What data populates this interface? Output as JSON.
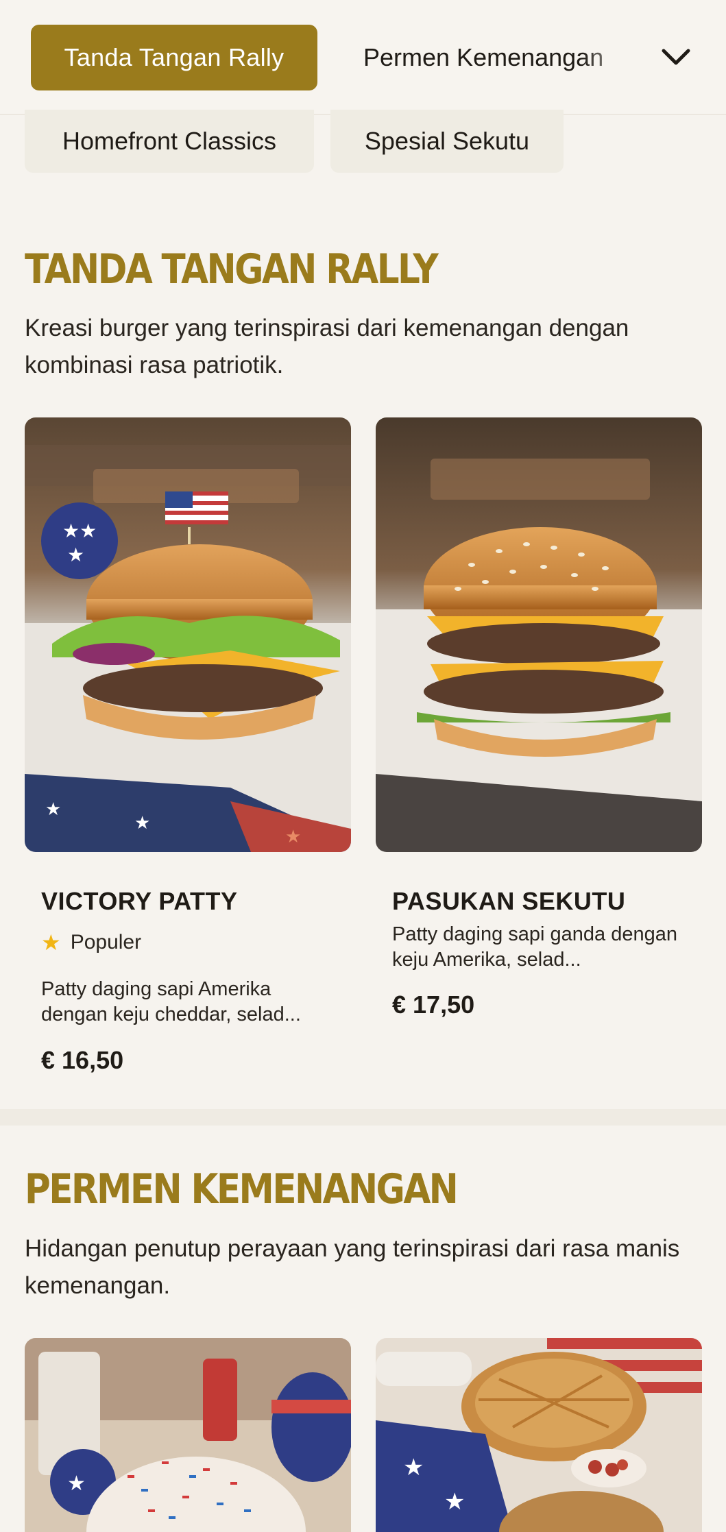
{
  "nav": {
    "active_tab": "Tanda Tangan Rally",
    "next_tab": "Permen Kemenangan",
    "pills": [
      "Homefront Classics",
      "Spesial Sekutu"
    ]
  },
  "sections": [
    {
      "title": "TANDA TANGAN RALLY",
      "description": "Kreasi burger yang terinspirasi dari kemenangan dengan kombinasi rasa patriotik.",
      "items": [
        {
          "name": "VICTORY PATTY",
          "badge": "Populer",
          "description": "Patty daging sapi Amerika dengan keju cheddar, selad...",
          "price": "€ 16,50"
        },
        {
          "name": "PASUKAN SEKUTU",
          "description": "Patty daging sapi ganda dengan keju Amerika, selad...",
          "price": "€ 17,50"
        }
      ]
    },
    {
      "title": "PERMEN KEMENANGAN",
      "description": "Hidangan penutup perayaan yang terinspirasi dari rasa manis kemenangan."
    }
  ],
  "colors": {
    "accent": "#9a7b1c",
    "background": "#f6f3ee",
    "pill_bg": "#efece3",
    "star": "#f1b514"
  },
  "icons": [
    "chevron-down-icon",
    "star-icon"
  ]
}
